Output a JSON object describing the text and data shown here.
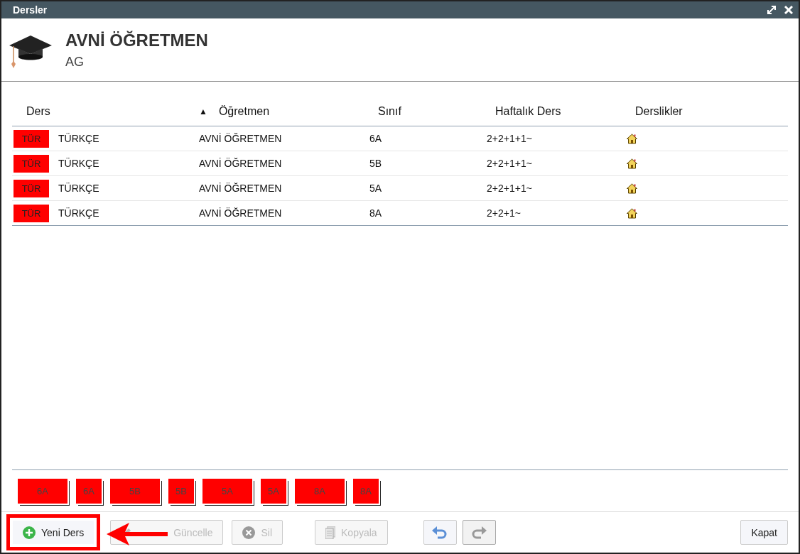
{
  "window": {
    "title": "Dersler"
  },
  "header": {
    "title": "AVNİ ÖĞRETMEN",
    "subtitle": "AG"
  },
  "table": {
    "columns": [
      {
        "label": "Ders"
      },
      {
        "label": "Öğretmen",
        "sort_mark": "▲"
      },
      {
        "label": "Sınıf"
      },
      {
        "label": "Haftalık Ders"
      },
      {
        "label": "Derslikler"
      }
    ],
    "rows": [
      {
        "code": "TÜR",
        "lesson": "TÜRKÇE",
        "teacher": "AVNİ ÖĞRETMEN",
        "class": "6A",
        "weekly": "2+2+1+1~"
      },
      {
        "code": "TÜR",
        "lesson": "TÜRKÇE",
        "teacher": "AVNİ ÖĞRETMEN",
        "class": "5B",
        "weekly": "2+2+1+1~"
      },
      {
        "code": "TÜR",
        "lesson": "TÜRKÇE",
        "teacher": "AVNİ ÖĞRETMEN",
        "class": "5A",
        "weekly": "2+2+1+1~"
      },
      {
        "code": "TÜR",
        "lesson": "TÜRKÇE",
        "teacher": "AVNİ ÖĞRETMEN",
        "class": "8A",
        "weekly": "2+2+1~"
      }
    ]
  },
  "blocks": [
    {
      "label": "6A",
      "kind": "double"
    },
    {
      "label": "6A",
      "kind": "single"
    },
    {
      "label": "5B",
      "kind": "double"
    },
    {
      "label": "5B",
      "kind": "single"
    },
    {
      "label": "5A",
      "kind": "double"
    },
    {
      "label": "5A",
      "kind": "single"
    },
    {
      "label": "8A",
      "kind": "double"
    },
    {
      "label": "8A",
      "kind": "single"
    }
  ],
  "buttons": [
    {
      "kind": "add",
      "label": "Yeni Ders",
      "disabled": false,
      "highlighted": true
    },
    {
      "kind": "edit",
      "label": "Güncelle",
      "disabled": true
    },
    {
      "kind": "delete",
      "label": "Sil",
      "disabled": true
    },
    {
      "kind": "copy",
      "label": "Kopyala",
      "disabled": true
    },
    {
      "kind": "undo",
      "disabled": false
    },
    {
      "kind": "redo",
      "disabled": true
    },
    {
      "kind": "close",
      "label": "Kapat",
      "disabled": false
    }
  ]
}
